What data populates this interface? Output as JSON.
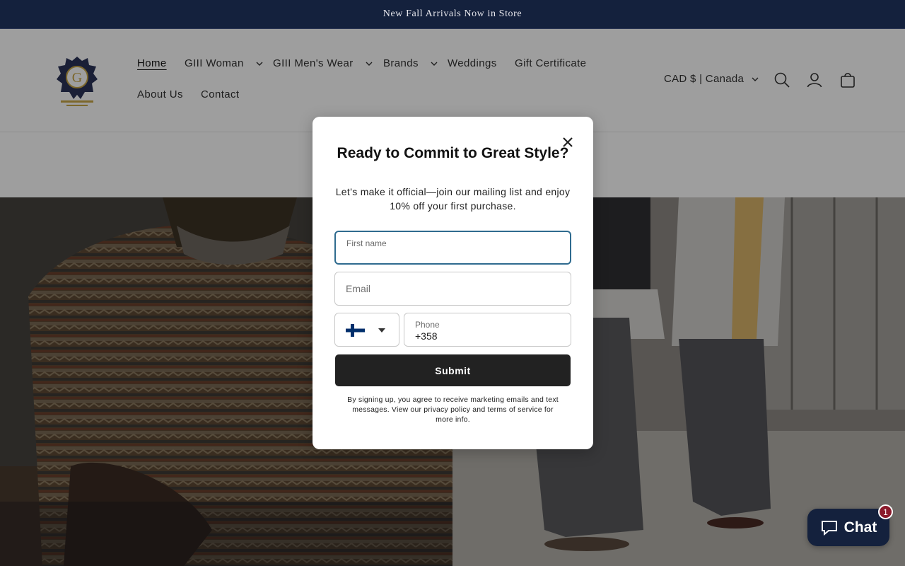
{
  "announcement": {
    "text": "New Fall Arrivals Now in Store"
  },
  "brand": {
    "logo_icon": "crest-logo-icon",
    "accent": "#14213d"
  },
  "nav": {
    "items": [
      {
        "label": "Home",
        "active": true,
        "dropdown": false
      },
      {
        "label": "GIII Woman",
        "dropdown": true
      },
      {
        "label": "GIII Men's Wear",
        "dropdown": true
      },
      {
        "label": "Brands",
        "dropdown": true
      },
      {
        "label": "Weddings",
        "dropdown": false
      },
      {
        "label": "Gift Certificate",
        "dropdown": false
      },
      {
        "label": "About Us",
        "dropdown": false
      },
      {
        "label": "Contact",
        "dropdown": false
      }
    ]
  },
  "header": {
    "country_selector": "CAD $ | Canada",
    "icons": [
      "search-icon",
      "account-icon",
      "cart-icon"
    ]
  },
  "modal": {
    "title": "Ready to Commit to Great Style?",
    "description": "Let’s make it official—join our mailing list and enjoy 10% off your first purchase.",
    "first_name_label": "First name",
    "email_placeholder": "Email",
    "phone_label": "Phone",
    "phone_value": "+358",
    "country_flag": "finland-flag-icon",
    "submit_label": "Submit",
    "legal": "By signing up, you agree to receive marketing emails and text messages. View our privacy policy and terms of service for more info."
  },
  "chat": {
    "label": "Chat",
    "badge_count": "1",
    "badge_color": "#8b1a2b"
  }
}
